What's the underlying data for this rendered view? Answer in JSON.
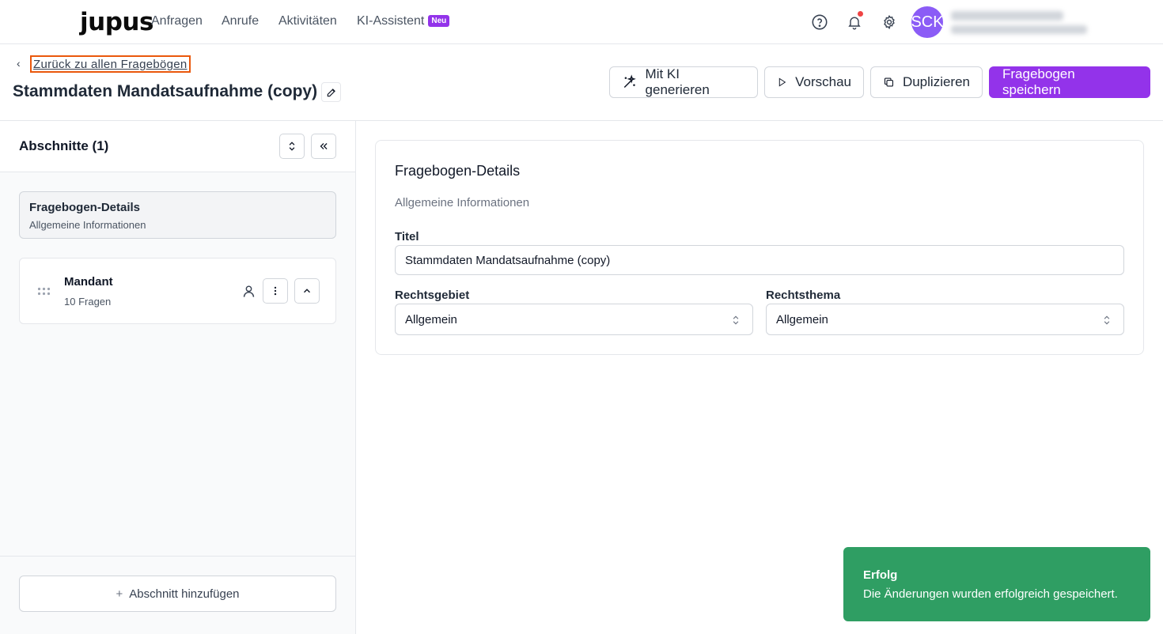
{
  "app": {
    "logo": "jupus"
  },
  "nav": {
    "items": [
      {
        "label": "Anfragen"
      },
      {
        "label": "Anrufe"
      },
      {
        "label": "Aktivitäten"
      },
      {
        "label": "KI-Assistent",
        "badge": "Neu"
      }
    ],
    "avatar_initials": "SCK"
  },
  "header": {
    "back_link": "Zurück zu allen Fragebögen",
    "title": "Stammdaten Mandatsaufnahme (copy)",
    "actions": {
      "generate": "Mit KI generieren",
      "preview": "Vorschau",
      "duplicate": "Duplizieren",
      "save": "Fragebogen speichern"
    }
  },
  "sidebar": {
    "title": "Abschnitte (1)",
    "details": {
      "title": "Fragebogen-Details",
      "subtitle": "Allgemeine Informationen"
    },
    "sections": [
      {
        "title": "Mandant",
        "count": "10 Fragen"
      }
    ],
    "add_section": "Abschnitt hinzufügen"
  },
  "main": {
    "card_title": "Fragebogen-Details",
    "card_subtitle": "Allgemeine Informationen",
    "title_label": "Titel",
    "title_value": "Stammdaten Mandatsaufnahme (copy)",
    "rechtsgebiet_label": "Rechtsgebiet",
    "rechtsgebiet_value": "Allgemein",
    "rechtsthema_label": "Rechtsthema",
    "rechtsthema_value": "Allgemein"
  },
  "toast": {
    "title": "Erfolg",
    "message": "Die Änderungen wurden erfolgreich gespeichert."
  },
  "colors": {
    "brand": "#9333ea",
    "success": "#2f9e63",
    "focus": "#ea580c",
    "avatar": "#8b5cf6",
    "notification": "#ef4444"
  },
  "icons": [
    "help-icon",
    "bell-icon",
    "gear-icon",
    "wand-icon",
    "play-icon",
    "copy-icon",
    "pencil-icon",
    "chevron-left-icon",
    "expand-collapse-icon",
    "double-chevron-left-icon",
    "drag-handle-icon",
    "person-icon",
    "more-vertical-icon",
    "chevron-up-icon",
    "plus-icon",
    "select-chevron-icon"
  ]
}
